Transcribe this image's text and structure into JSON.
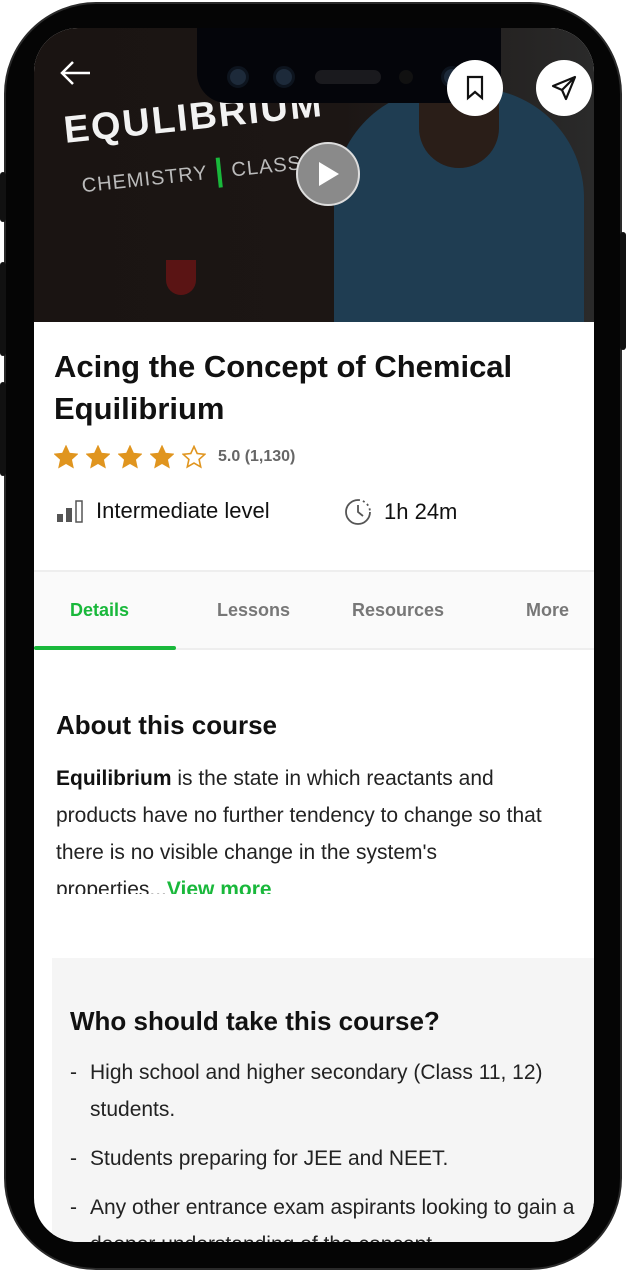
{
  "hero": {
    "thumbnail_title": "EQULIBRIUM",
    "thumbnail_subject": "CHEMISTRY",
    "thumbnail_class": "CLASS"
  },
  "course": {
    "title": "Acing the Concept of Chemical Equilibrium",
    "rating_stars": 4,
    "rating_max": 5,
    "rating_text": "5.0 (1,130)",
    "level": "Intermediate level",
    "duration": "1h 24m"
  },
  "tabs": [
    {
      "label": "Details",
      "active": true
    },
    {
      "label": "Lessons"
    },
    {
      "label": "Resources"
    },
    {
      "label": "More"
    }
  ],
  "about": {
    "heading": "About this course",
    "bold": "Equilibrium",
    "text": " is the state in which reactants and products have no further tendency to change so that there is no visible change in the system's properties...",
    "view_more": "View more"
  },
  "who": {
    "heading": "Who should take this course?",
    "items": [
      "High school and higher secondary (Class 11, 12) students.",
      "Students preparing for JEE and NEET.",
      "Any other entrance exam aspirants looking to gain a deeper understanding of the concept."
    ]
  },
  "colors": {
    "accent": "#19b83b",
    "star": "#e0951f"
  }
}
